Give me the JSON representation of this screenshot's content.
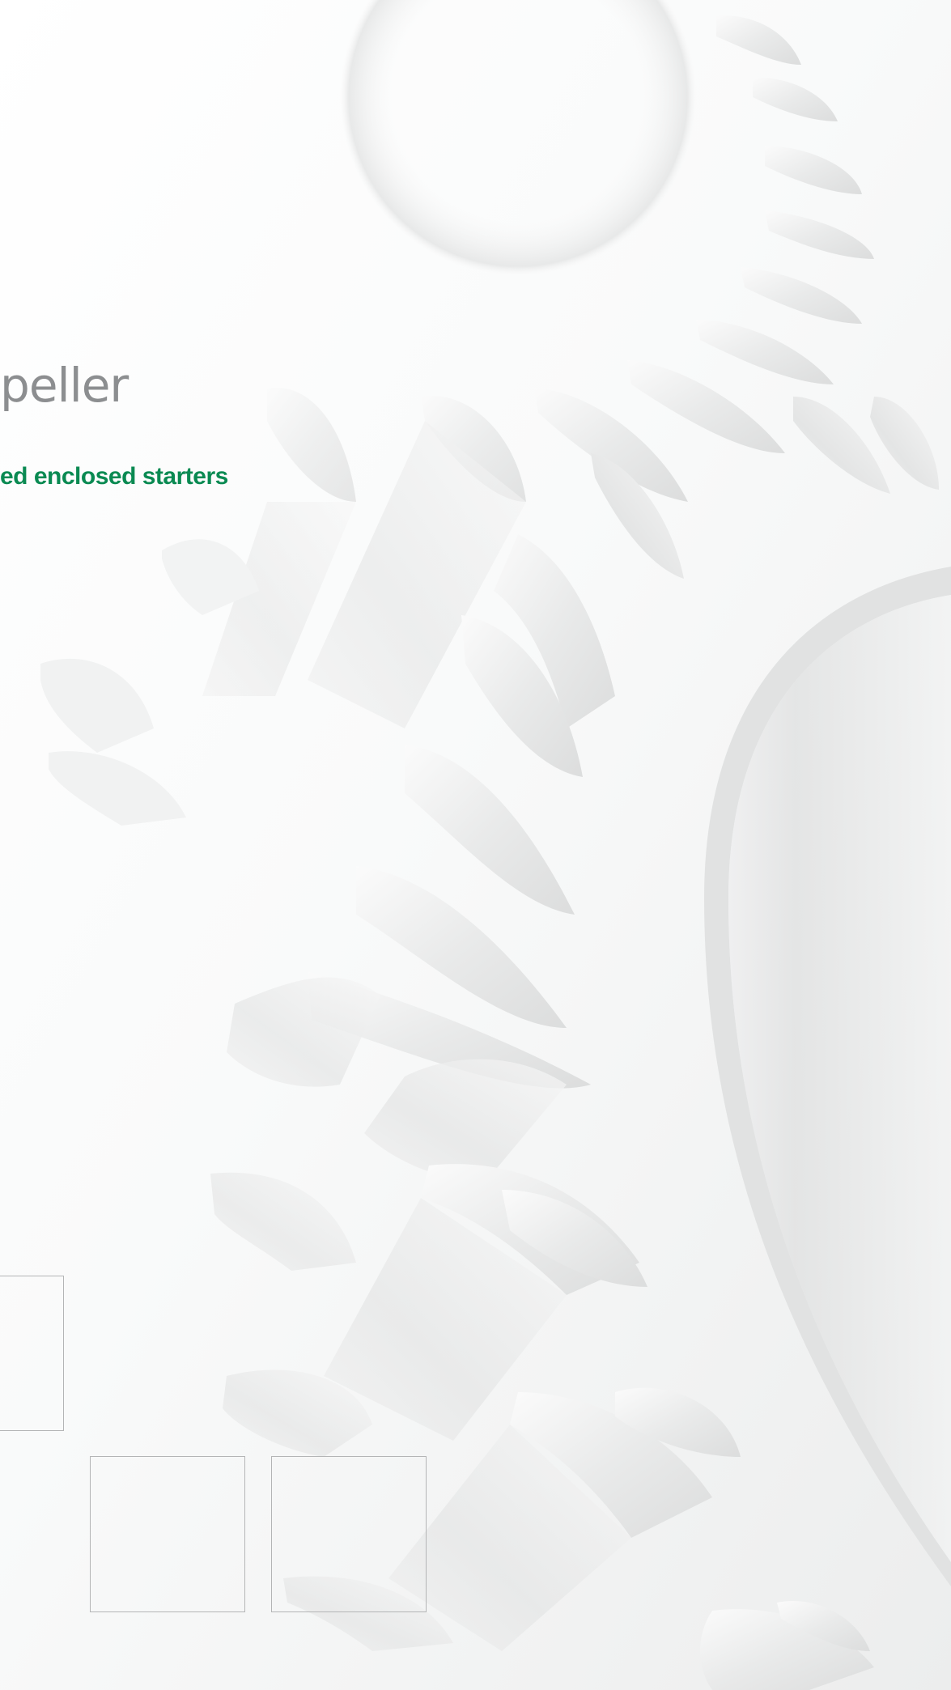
{
  "cover": {
    "title_fragment": "peller",
    "subtitle_fragment": "ed enclosed starters",
    "colors": {
      "title": "#8c8e90",
      "subtitle": "#0a8a52",
      "background": "#f4f5f5",
      "gear": "#e6e7e7",
      "frame_border": "#b4b5b6"
    },
    "background_graphic": "gear-illustration",
    "image_placeholders": [
      "empty-frame",
      "empty-frame",
      "empty-frame"
    ]
  }
}
